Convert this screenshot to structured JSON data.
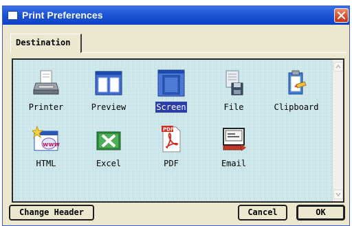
{
  "window": {
    "title": "Print Preferences"
  },
  "tabs": [
    {
      "label": "Destination",
      "selected": true
    }
  ],
  "destinations": [
    {
      "label": "Printer",
      "icon": "printer-icon",
      "selected": false
    },
    {
      "label": "Preview",
      "icon": "preview-icon",
      "selected": false
    },
    {
      "label": "Screen",
      "icon": "screen-icon",
      "selected": true
    },
    {
      "label": "File",
      "icon": "file-icon",
      "selected": false
    },
    {
      "label": "Clipboard",
      "icon": "clipboard-icon",
      "selected": false
    },
    {
      "label": "HTML",
      "icon": "html-icon",
      "selected": false
    },
    {
      "label": "Excel",
      "icon": "excel-icon",
      "selected": false
    },
    {
      "label": "PDF",
      "icon": "pdf-icon",
      "selected": false
    },
    {
      "label": "Email",
      "icon": "email-icon",
      "selected": false
    }
  ],
  "icon_text": {
    "pdf_badge": "PDF",
    "html_badge": "www"
  },
  "buttons": {
    "change_header": "Change Header",
    "cancel": "Cancel",
    "ok": "OK"
  },
  "colors": {
    "titlebar": "#1d55d6",
    "panel_background": "#9fd2dc",
    "selection": "#2c3fa8",
    "dialog_background": "#ece8cf"
  }
}
